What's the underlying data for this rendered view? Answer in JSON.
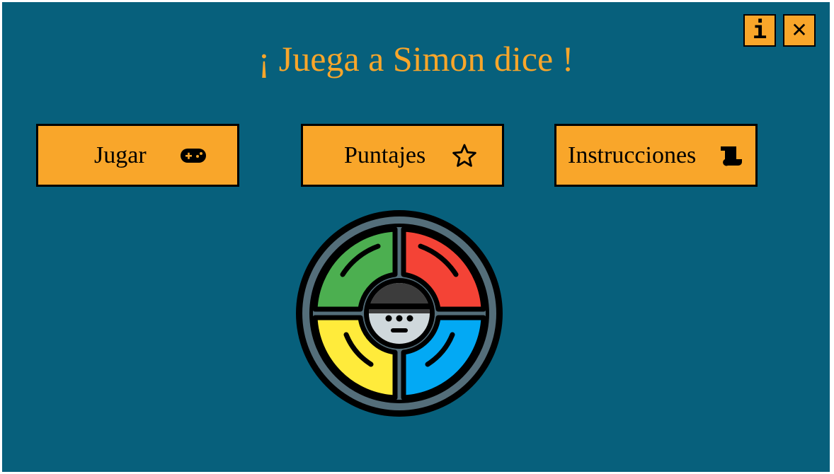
{
  "app": {
    "title": "¡ Juega a Simon dice !",
    "accent_color": "#f9a62a",
    "background_color": "#07607c"
  },
  "top_buttons": [
    {
      "icon": "info-icon",
      "glyph": "i"
    },
    {
      "icon": "close-icon",
      "glyph": "✕"
    }
  ],
  "menu": [
    {
      "label": "Jugar",
      "icon": "gamepad-icon"
    },
    {
      "label": "Puntajes",
      "icon": "star-icon"
    },
    {
      "label": "Instrucciones",
      "icon": "scroll-icon"
    }
  ],
  "simon_game": {
    "icon": "simon-game-icon",
    "colors": {
      "green": "#4caf50",
      "red": "#f44336",
      "yellow": "#ffeb3b",
      "blue": "#03a9f4"
    }
  }
}
